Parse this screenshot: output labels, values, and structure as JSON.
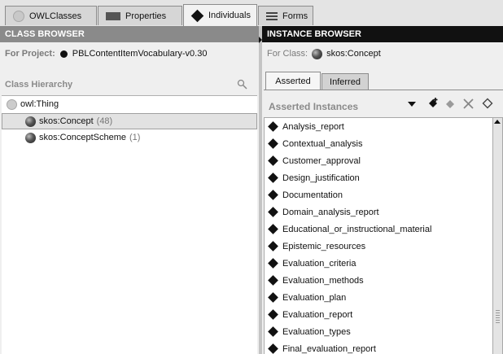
{
  "tabs": [
    {
      "label": "OWLClasses",
      "icon": "owl-class-circle-icon"
    },
    {
      "label": "Properties",
      "icon": "properties-rect-icon"
    },
    {
      "label": "Individuals",
      "icon": "individual-diamond-icon"
    },
    {
      "label": "Forms",
      "icon": "forms-lines-icon"
    }
  ],
  "class_browser": {
    "header": "CLASS BROWSER",
    "project_label": "For Project:",
    "project_name": "PBLContentItemVocabulary-v0.30",
    "hierarchy_label": "Class Hierarchy",
    "tree": [
      {
        "label": "owl:Thing",
        "count": ""
      },
      {
        "label": "skos:Concept",
        "count": "(48)"
      },
      {
        "label": "skos:ConceptScheme",
        "count": "(1)"
      }
    ]
  },
  "instance_browser": {
    "header": "INSTANCE BROWSER",
    "for_class_label": "For Class:",
    "for_class_name": "skos:Concept",
    "subtabs": [
      "Asserted",
      "Inferred"
    ],
    "instances_title": "Asserted Instances",
    "instances": [
      "Analysis_report",
      "Contextual_analysis",
      "Customer_approval",
      "Design_justification",
      "Documentation",
      "Domain_analysis_report",
      "Educational_or_instructional_material",
      "Epistemic_resources",
      "Evaluation_criteria",
      "Evaluation_methods",
      "Evaluation_plan",
      "Evaluation_report",
      "Evaluation_types",
      "Final_evaluation_report"
    ]
  }
}
